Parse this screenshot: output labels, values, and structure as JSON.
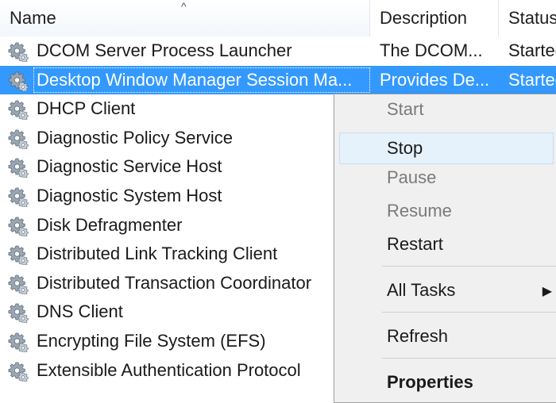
{
  "columns": {
    "name": "Name",
    "description": "Description",
    "status": "Status"
  },
  "rows": [
    {
      "name": "DCOM Server Process Launcher",
      "description": "The DCOM...",
      "status": "Started",
      "selected": false
    },
    {
      "name": "Desktop Window Manager Session Ma...",
      "description": "Provides De...",
      "status": "Started",
      "selected": true
    },
    {
      "name": "DHCP Client",
      "description": "",
      "status": "",
      "selected": false
    },
    {
      "name": "Diagnostic Policy Service",
      "description": "",
      "status": "",
      "selected": false
    },
    {
      "name": "Diagnostic Service Host",
      "description": "",
      "status": "",
      "selected": false
    },
    {
      "name": "Diagnostic System Host",
      "description": "",
      "status": "",
      "selected": false
    },
    {
      "name": "Disk Defragmenter",
      "description": "",
      "status": "",
      "selected": false
    },
    {
      "name": "Distributed Link Tracking Client",
      "description": "",
      "status": "",
      "selected": false
    },
    {
      "name": "Distributed Transaction Coordinator",
      "description": "",
      "status": "",
      "selected": false
    },
    {
      "name": "DNS Client",
      "description": "",
      "status": "",
      "selected": false
    },
    {
      "name": "Encrypting File System (EFS)",
      "description": "",
      "status": "",
      "selected": false
    },
    {
      "name": "Extensible Authentication Protocol",
      "description": "",
      "status": "",
      "selected": false
    }
  ],
  "context_menu": {
    "start": "Start",
    "stop": "Stop",
    "pause": "Pause",
    "resume": "Resume",
    "restart": "Restart",
    "all_tasks": "All Tasks",
    "refresh": "Refresh",
    "properties": "Properties"
  },
  "colors": {
    "selection": "#3399ff",
    "highlight_oval": "#d31f26"
  },
  "icons": {
    "row_icon": "service-gear-icon",
    "sort": "sort-up-icon",
    "submenu": "submenu-arrow-icon"
  }
}
